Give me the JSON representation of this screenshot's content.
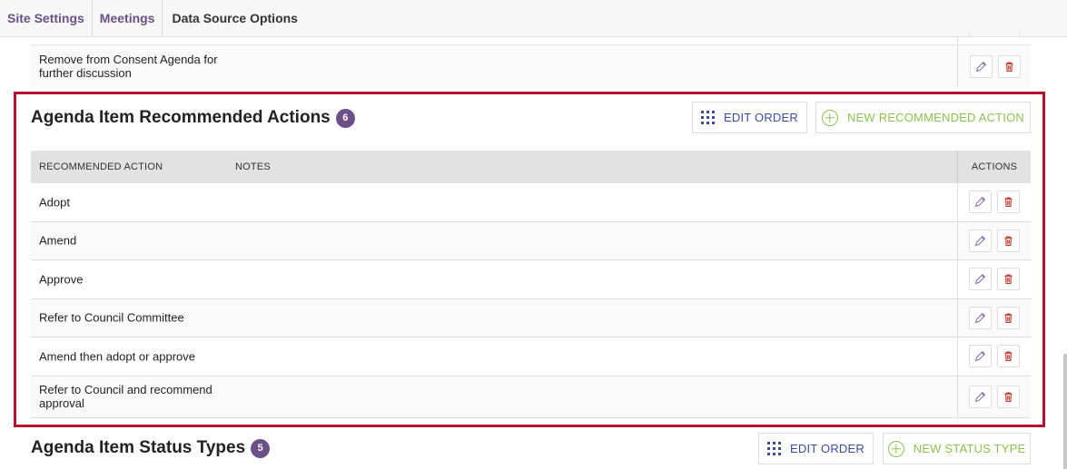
{
  "breadcrumb": {
    "items": [
      "Site Settings",
      "Meetings"
    ],
    "current": "Data Source Options"
  },
  "top_table": {
    "row_label": "Remove from Consent Agenda for further discussion"
  },
  "recommended_actions": {
    "title": "Agenda Item Recommended Actions",
    "count": "6",
    "edit_order_label": "EDIT ORDER",
    "new_label": "NEW RECOMMENDED ACTION",
    "columns": {
      "action": "RECOMMENDED ACTION",
      "notes": "NOTES",
      "actions": "ACTIONS"
    },
    "rows": [
      {
        "label": "Adopt"
      },
      {
        "label": "Amend"
      },
      {
        "label": "Approve"
      },
      {
        "label": "Refer to Council Committee"
      },
      {
        "label": "Amend then adopt or approve"
      },
      {
        "label": "Refer to Council and recommend approval"
      }
    ]
  },
  "status_types": {
    "title": "Agenda Item Status Types",
    "count": "5",
    "edit_order_label": "EDIT ORDER",
    "new_label": "NEW STATUS TYPE"
  },
  "colors": {
    "accent_purple": "#6b4f87",
    "edit_blue": "#3b4d9a",
    "new_green": "#8cc152",
    "highlight_red": "#b5122b",
    "delete_red": "#c0392b"
  },
  "icons": {
    "edit": "pencil-icon",
    "delete": "trash-icon",
    "reorder": "grid-dots-icon",
    "add": "plus-circle-icon"
  }
}
